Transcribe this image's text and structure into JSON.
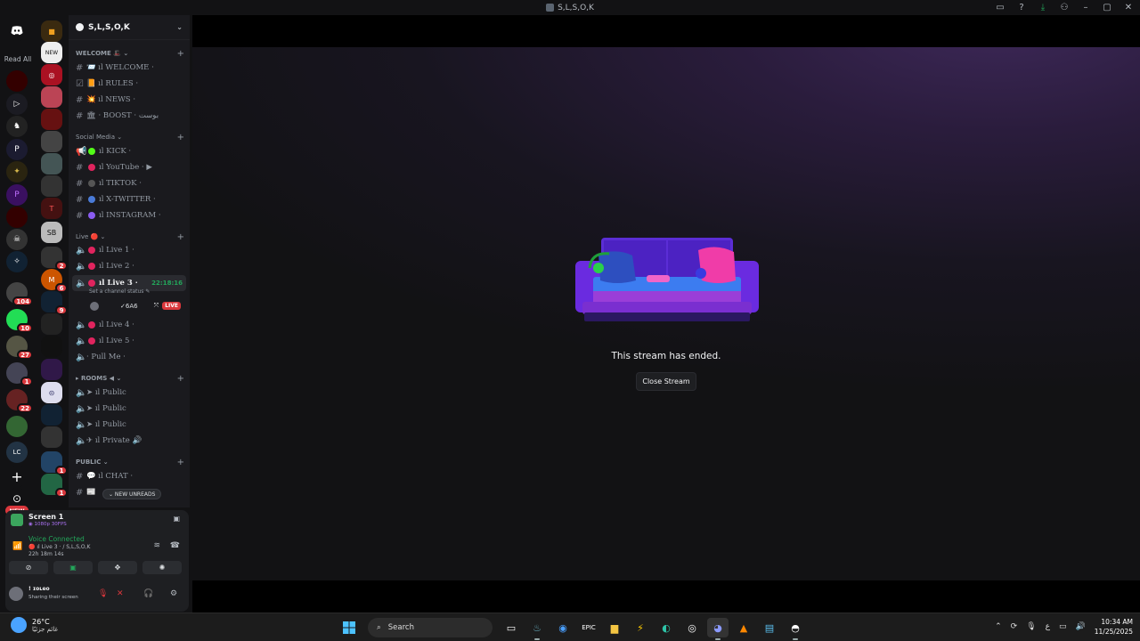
{
  "window": {
    "title": "S,L,S,O,K"
  },
  "rail": {
    "read_all": "Read All",
    "new_label": "NEW",
    "badges": [
      "104",
      "10",
      "27",
      "1",
      "22",
      "LC",
      "2",
      "6",
      "9",
      "1",
      "1"
    ]
  },
  "server": {
    "name": "S,L,S,O,K"
  },
  "categories": {
    "welcome": "WELCOME 🎩 ⌄",
    "social": "Social Media ⌄",
    "live": "Live 🔴 ⌄",
    "rooms": "▸ ROOMS ◀ ⌄",
    "public": "PUBLIC ⌄"
  },
  "channels": {
    "welcome": "📨 ıl WELCOME ·",
    "rules": "📙 ıl RULES ·",
    "news": "💥 ıl NEWS ·",
    "boost": "🏛 · BOOST · بوست",
    "kick": "ıl KICK ·",
    "youtube": "ıl YouTube · ▶",
    "tiktok": "ıl TIKTOK ·",
    "twitter": "ıl X-TWITTER ·",
    "instagram": "ıl INSTAGRAM ·",
    "live1": "ıl Live 1 ·",
    "live2": "ıl Live 2 ·",
    "live3": "ıl Live 3 ·",
    "live3_time": "22:18:16",
    "live3_status": "Set a channel status ✎",
    "live4": "ıl Live 4 ·",
    "live5": "ıl Live 5 ·",
    "pullme": "· Pull Me ·",
    "public1": "➤ ıl Public",
    "public2": "➤ ıl Public",
    "public3": "➤ ıl Public",
    "private": "✈ ıl Private 🔊",
    "chat": "💬 ıl CHAT ·",
    "extra": "📰"
  },
  "voice_user": {
    "name": "✓6A6",
    "live": "LIVE"
  },
  "new_unreads": "⌄ NEW UNREADS",
  "panel": {
    "screen_title": "Screen 1",
    "screen_sub": "◉ 1080p 30FPS",
    "voice_connected": "Voice Connected",
    "voice_channel": "🔴 ıl Live 3 · / S,L,S,O,K",
    "elapsed": "22h 18m 14s",
    "user_name": "! ɪoʟeo",
    "user_status": "Sharing their screen"
  },
  "stream": {
    "ended_text": "This stream has ended.",
    "close_label": "Close Stream"
  },
  "taskbar": {
    "temp": "26°C",
    "weather_desc": "غائم جزئيًا",
    "search_label": "Search",
    "time": "10:34 AM",
    "date": "11/25/2025",
    "lang": "ع"
  },
  "colors": {
    "live_red": "#da373c",
    "voice_green": "#23a55a",
    "kick_green": "#53fc18",
    "accent_purple": "#a970f0"
  }
}
